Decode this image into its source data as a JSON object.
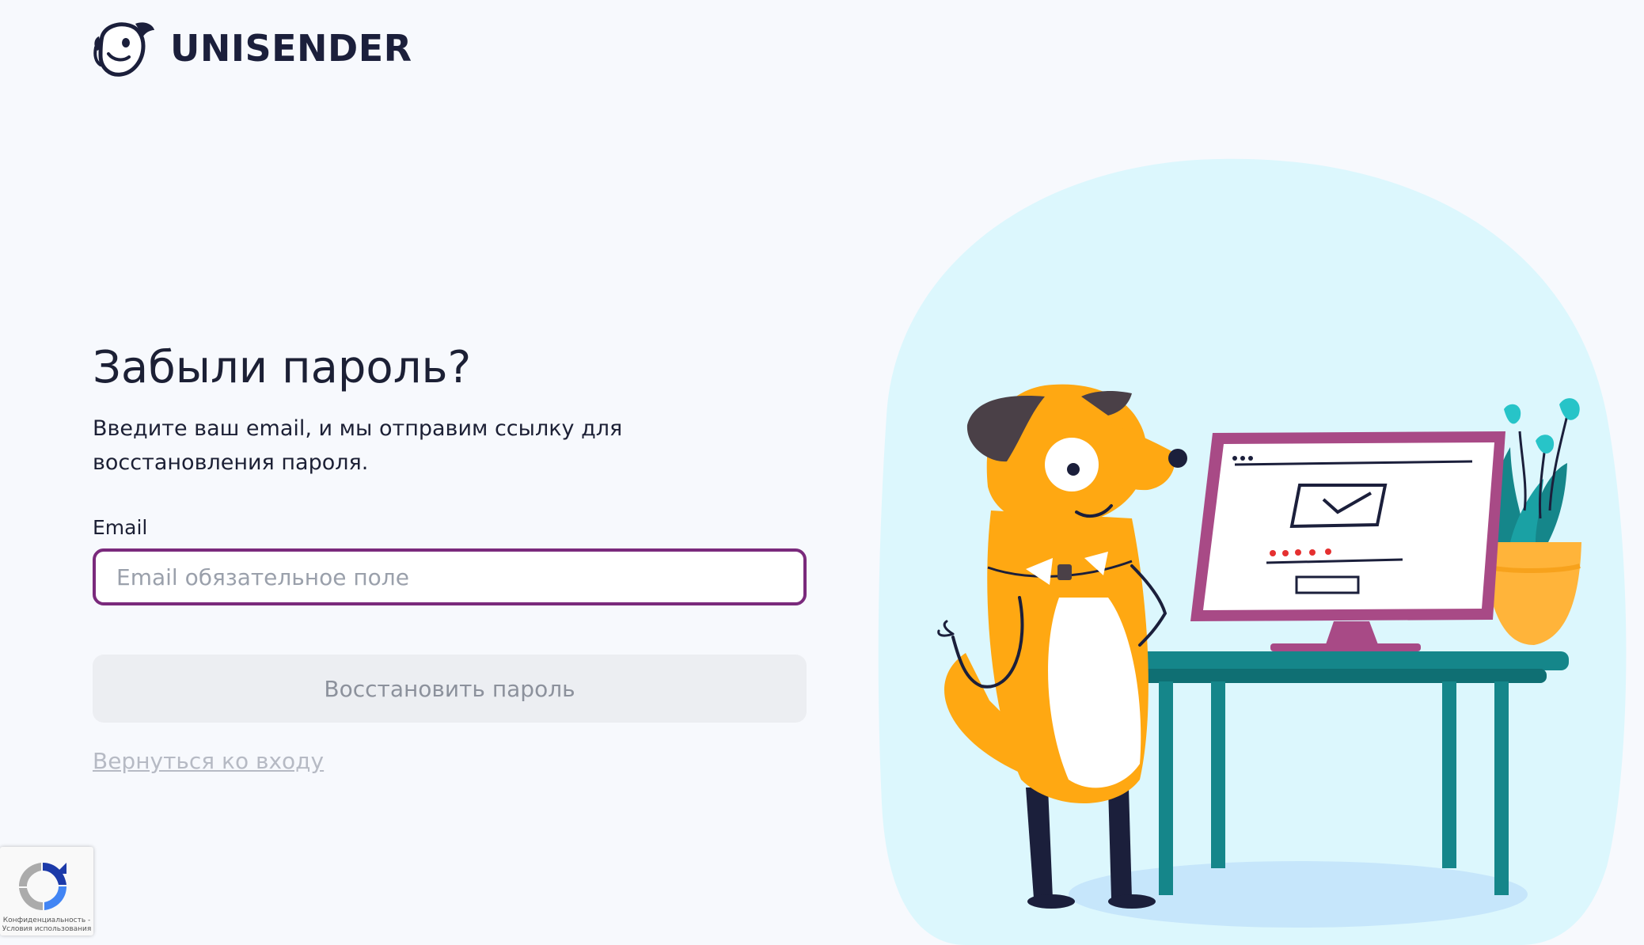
{
  "brand": {
    "name": "UNISENDER",
    "logo_icon": "dog-head-logo-icon",
    "text_color": "#1b1f3b"
  },
  "form": {
    "title": "Забыли пароль?",
    "description": "Введите ваш email, и мы отправим ссылку для восстановления пароля.",
    "email_label": "Email",
    "email_value": "",
    "email_placeholder": "Email обязательное поле",
    "submit_label": "Восстановить пароль",
    "back_link_label": "Вернуться ко входу",
    "focus_border_color": "#7a2a7c"
  },
  "recaptcha": {
    "icon": "recaptcha-icon",
    "privacy_label": "Конфиденциальность -",
    "terms_label": "Условия использования"
  },
  "illustration": {
    "subject": "dog-at-computer-illustration",
    "blob_color": "#dcf7fd",
    "dog_color": "#ffa812",
    "desk_color": "#15868a",
    "monitor_frame_color": "#a84a86"
  }
}
